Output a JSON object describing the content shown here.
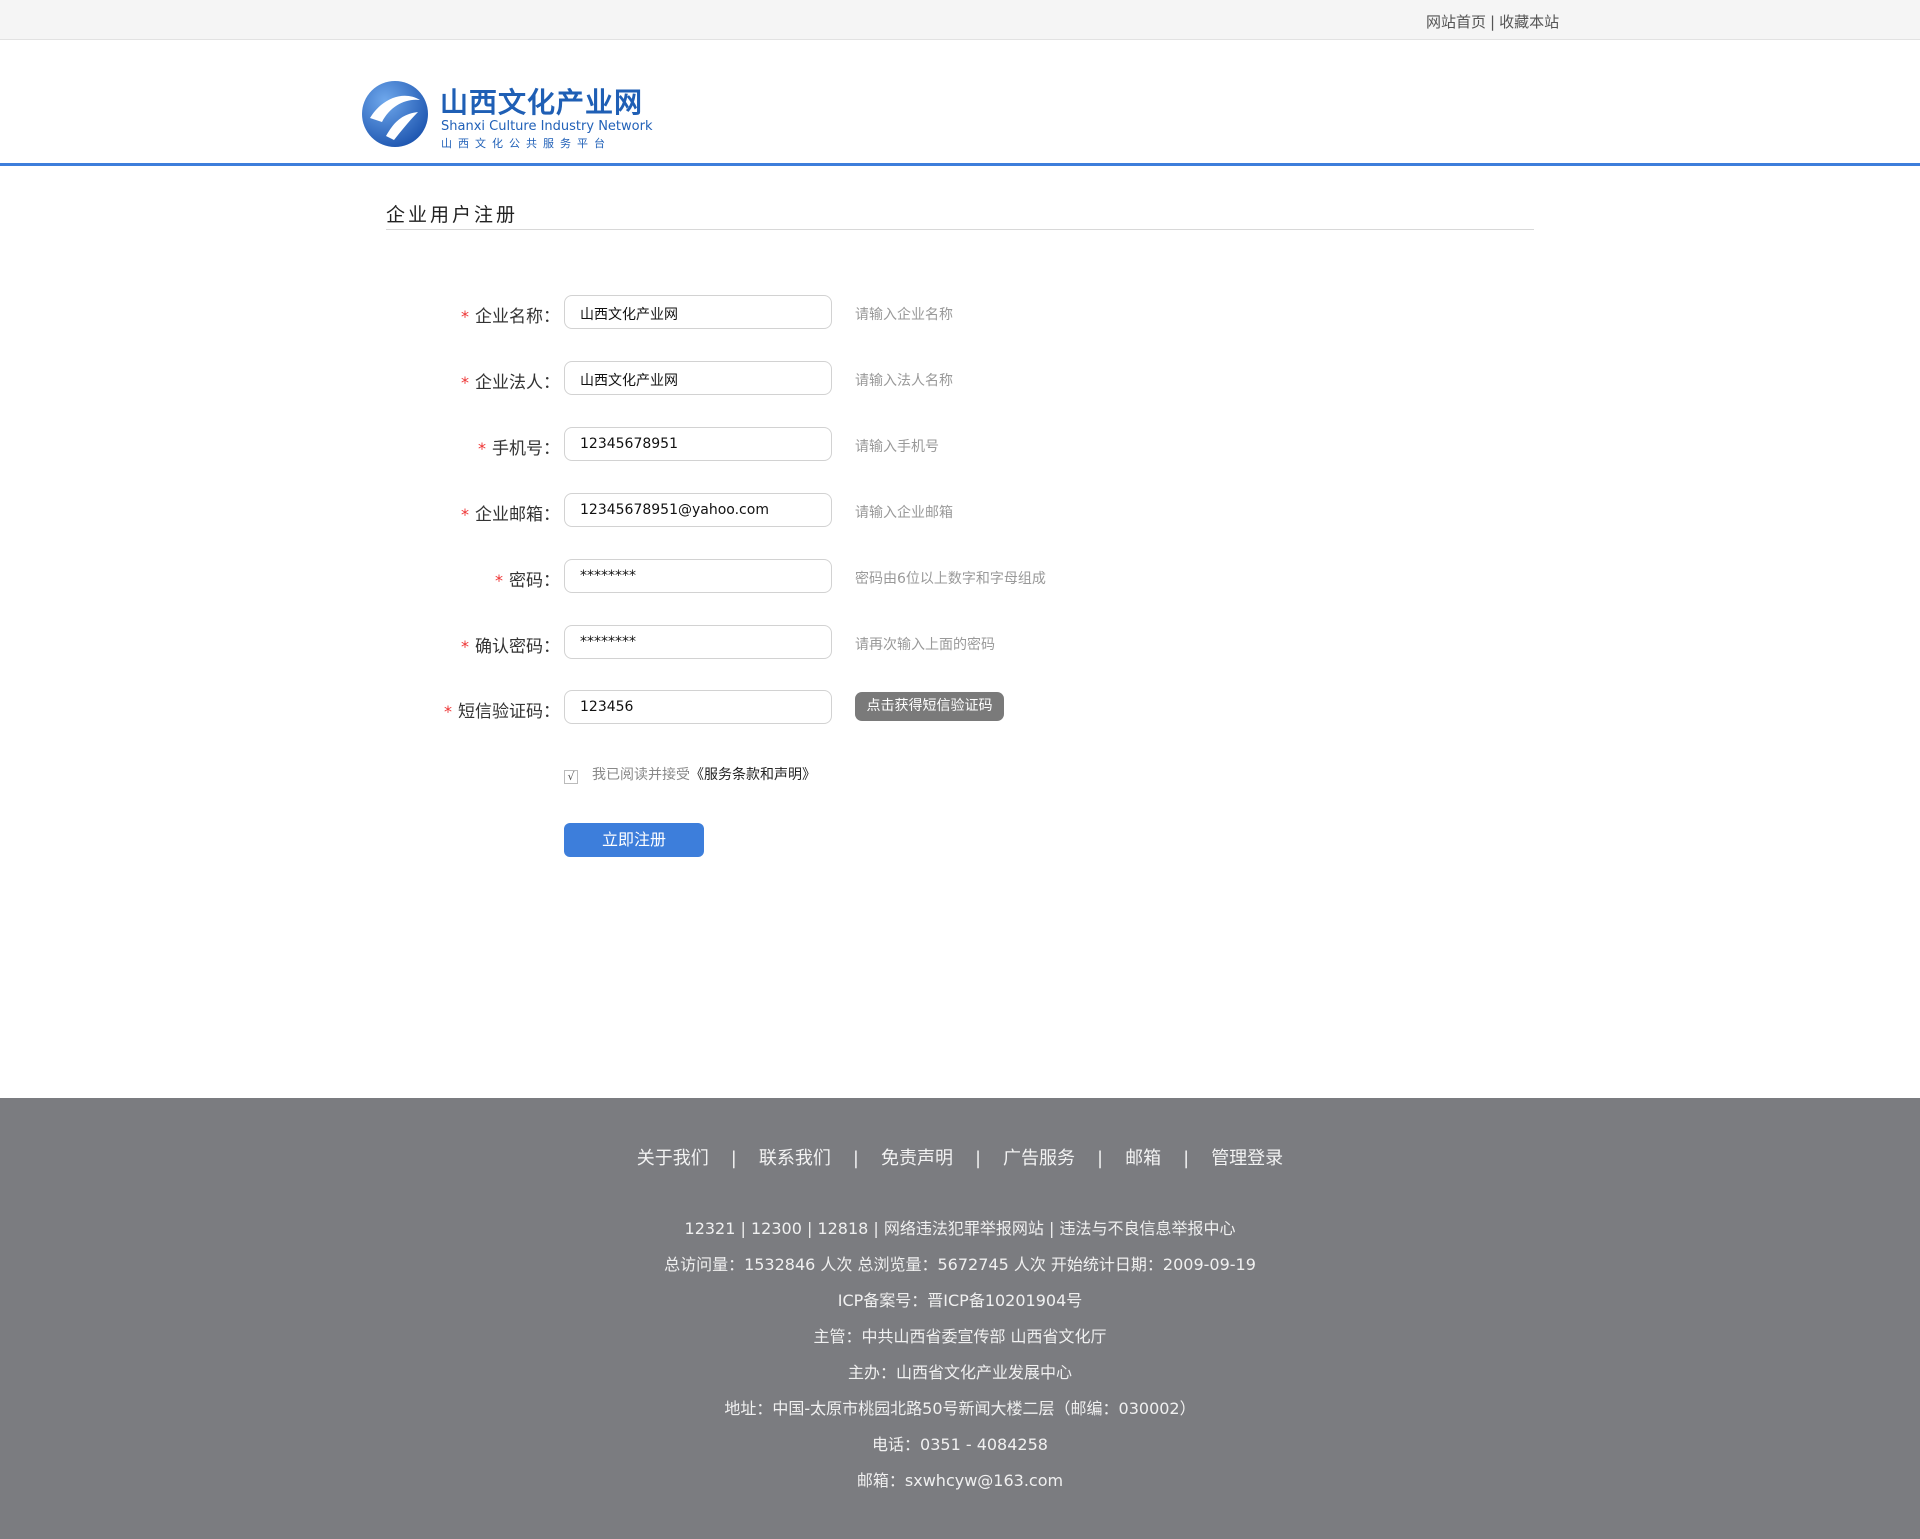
{
  "topbar": {
    "home_link": "网站首页",
    "separator": "|",
    "bookmark_link": "收藏本站"
  },
  "logo": {
    "name_cn": "山西文化产业网",
    "name_en": "Shanxi Culture Industry Network",
    "tagline": "山西文化公共服务平台"
  },
  "page": {
    "title": "企业用户注册"
  },
  "form": {
    "required_mark": "*",
    "fields": [
      {
        "label": "企业名称：",
        "value": "山西文化产业网",
        "hint": "请输入企业名称"
      },
      {
        "label": "企业法人：",
        "value": "山西文化产业网",
        "hint": "请输入法人名称"
      },
      {
        "label": "手机号：",
        "value": "12345678951",
        "hint": "请输入手机号"
      },
      {
        "label": "企业邮箱：",
        "value": "12345678951@yahoo.com",
        "hint": "请输入企业邮箱"
      },
      {
        "label": "密码：",
        "value": "********",
        "hint": "密码由6位以上数字和字母组成"
      },
      {
        "label": "确认密码：",
        "value": "********",
        "hint": "请再次输入上面的密码"
      },
      {
        "label": "短信验证码：",
        "value": "123456",
        "button": "点击获得短信验证码"
      }
    ],
    "agree_check": "√",
    "agree_text": "我已阅读并接受",
    "agree_terms": "《服务条款和声明》",
    "submit_label": "立即注册"
  },
  "footer": {
    "nav": [
      "关于我们",
      "联系我们",
      "免责声明",
      "广告服务",
      "邮箱",
      "管理登录"
    ],
    "nav_separator": "|",
    "lines": [
      "12321 | 12300 | 12818 | 网络违法犯罪举报网站 | 违法与不良信息举报中心",
      "总访问量：1532846 人次  总浏览量：5672745 人次  开始统计日期：2009-09-19",
      "ICP备案号：晋ICP备10201904号",
      "主管：中共山西省委宣传部 山西省文化厅",
      "主办：山西省文化产业发展中心",
      "地址：中国-太原市桃园北路50号新闻大楼二层（邮编：030002）",
      "电话：0351 - 4084258",
      "邮箱：sxwhcyw@163.com"
    ]
  },
  "colors": {
    "accent": "#3d7edb",
    "footer_bg": "#7b7c80",
    "required": "#ee3333",
    "sms_button": "#7a7a7a"
  },
  "icons": {
    "logo_mark": "swoosh-logo-icon"
  }
}
